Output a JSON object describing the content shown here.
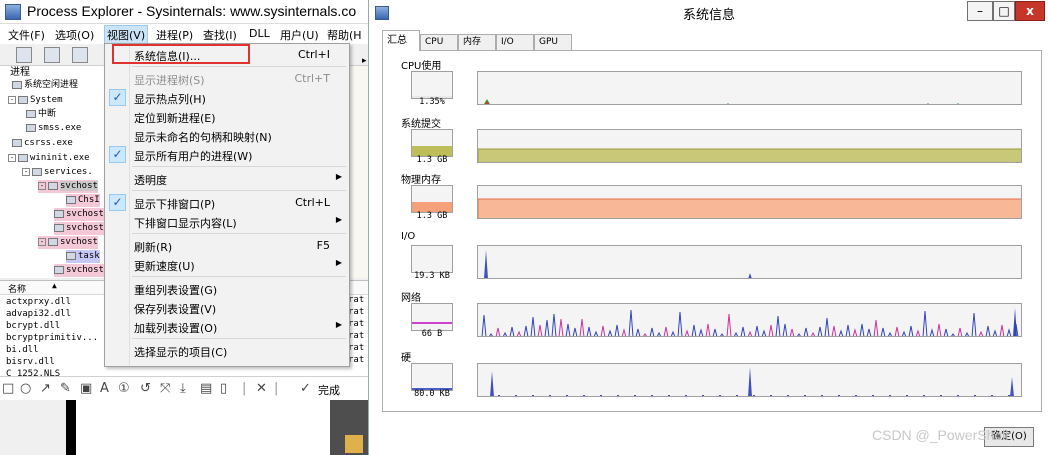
{
  "pe": {
    "title": "Process Explorer - Sysinternals: www.sysinternals.co",
    "menubar": [
      "文件(F)",
      "选项(O)",
      "视图(V)",
      "进程(P)",
      "查找(I)",
      "DLL",
      "用户(U)",
      "帮助(H"
    ],
    "tree_header": "进程",
    "tree": [
      {
        "label": "系统空闲进程"
      },
      {
        "label": "System"
      },
      {
        "label": "中断"
      },
      {
        "label": "smss.exe"
      },
      {
        "label": "csrss.exe"
      },
      {
        "label": "wininit.exe"
      },
      {
        "label": "services."
      },
      {
        "label": "svchost"
      },
      {
        "label": "ChsI"
      },
      {
        "label": "svchost"
      },
      {
        "label": "svchost"
      },
      {
        "label": "svchost"
      },
      {
        "label": "task"
      },
      {
        "label": "svchost"
      }
    ],
    "lower_header": "名称",
    "dlls": [
      "actxprxy.dll",
      "advapi32.dll",
      "bcrypt.dll",
      "bcryptprimitiv...",
      "bi.dll",
      "bisrv.dll",
      "C_1252.NLS"
    ],
    "right_fragments": [
      "rat",
      "rat",
      "rat",
      "rat",
      "rat",
      "rat"
    ]
  },
  "view_menu": {
    "items": [
      {
        "label": "系统信息(I)...",
        "shortcut": "Ctrl+I",
        "checked": false,
        "disabled": false,
        "submenu": false
      },
      {
        "sep": true
      },
      {
        "label": "显示进程树(S)",
        "shortcut": "Ctrl+T",
        "checked": false,
        "disabled": true,
        "submenu": false
      },
      {
        "label": "显示热点列(H)",
        "shortcut": "",
        "checked": true,
        "disabled": false,
        "submenu": false
      },
      {
        "label": "定位到新进程(E)",
        "shortcut": "",
        "checked": false,
        "disabled": false,
        "submenu": false
      },
      {
        "label": "显示未命名的句柄和映射(N)",
        "shortcut": "",
        "checked": false,
        "disabled": false,
        "submenu": false
      },
      {
        "label": "显示所有用户的进程(W)",
        "shortcut": "",
        "checked": true,
        "disabled": false,
        "submenu": false
      },
      {
        "sep": true
      },
      {
        "label": "透明度",
        "shortcut": "",
        "checked": false,
        "disabled": false,
        "submenu": true
      },
      {
        "sep": true
      },
      {
        "label": "显示下排窗口(P)",
        "shortcut": "Ctrl+L",
        "checked": true,
        "disabled": false,
        "submenu": false
      },
      {
        "label": "下排窗口显示内容(L)",
        "shortcut": "",
        "checked": false,
        "disabled": false,
        "submenu": true
      },
      {
        "sep": true
      },
      {
        "label": "刷新(R)",
        "shortcut": "F5",
        "checked": false,
        "disabled": false,
        "submenu": false
      },
      {
        "label": "更新速度(U)",
        "shortcut": "",
        "checked": false,
        "disabled": false,
        "submenu": true
      },
      {
        "sep": true
      },
      {
        "label": "重组列表设置(G)",
        "shortcut": "",
        "checked": false,
        "disabled": false,
        "submenu": false
      },
      {
        "label": "保存列表设置(V)",
        "shortcut": "",
        "checked": false,
        "disabled": false,
        "submenu": false
      },
      {
        "label": "加载列表设置(O)",
        "shortcut": "",
        "checked": false,
        "disabled": false,
        "submenu": true
      },
      {
        "sep": true
      },
      {
        "label": "选择显示的项目(C)",
        "shortcut": "",
        "checked": false,
        "disabled": false,
        "submenu": false
      }
    ]
  },
  "snip": {
    "done_label": "完成"
  },
  "sysinfo": {
    "title": "系统信息",
    "window_buttons": [
      "–",
      "□",
      "x"
    ],
    "tabs": [
      "汇总",
      "CPU",
      "内存",
      "I/O",
      "GPU"
    ],
    "sections": [
      {
        "title": "CPU使用",
        "value": "1.35%",
        "fill_level": 0.0135,
        "fill_color": "#e8e8e8"
      },
      {
        "title": "系统提交",
        "value": "1.3 GB",
        "fill_level": 0.35,
        "fill_color": "#bdbd5a"
      },
      {
        "title": "物理内存",
        "value": "1.3 GB",
        "fill_level": 0.35,
        "fill_color": "#f4a07a"
      },
      {
        "title": "I/O",
        "value": "19.3  KB",
        "fill_level": 0.0,
        "fill_color": "#4a5ec8"
      },
      {
        "title": "网络",
        "value": "66 B",
        "fill_level": 0.05,
        "fill_color": "#cc44cc"
      },
      {
        "title": "硬",
        "value": "80.0  KB",
        "fill_level": 0.03,
        "fill_color": "#4a5ec8"
      }
    ],
    "ok_label": "确定(O)"
  },
  "watermark": "CSDN @_PowerShell",
  "colors": {
    "commit": "#c8c878",
    "physical": "#f8b898",
    "io": "#4050c0",
    "net_send": "#cc3399",
    "accent_red": "#e0322f"
  }
}
